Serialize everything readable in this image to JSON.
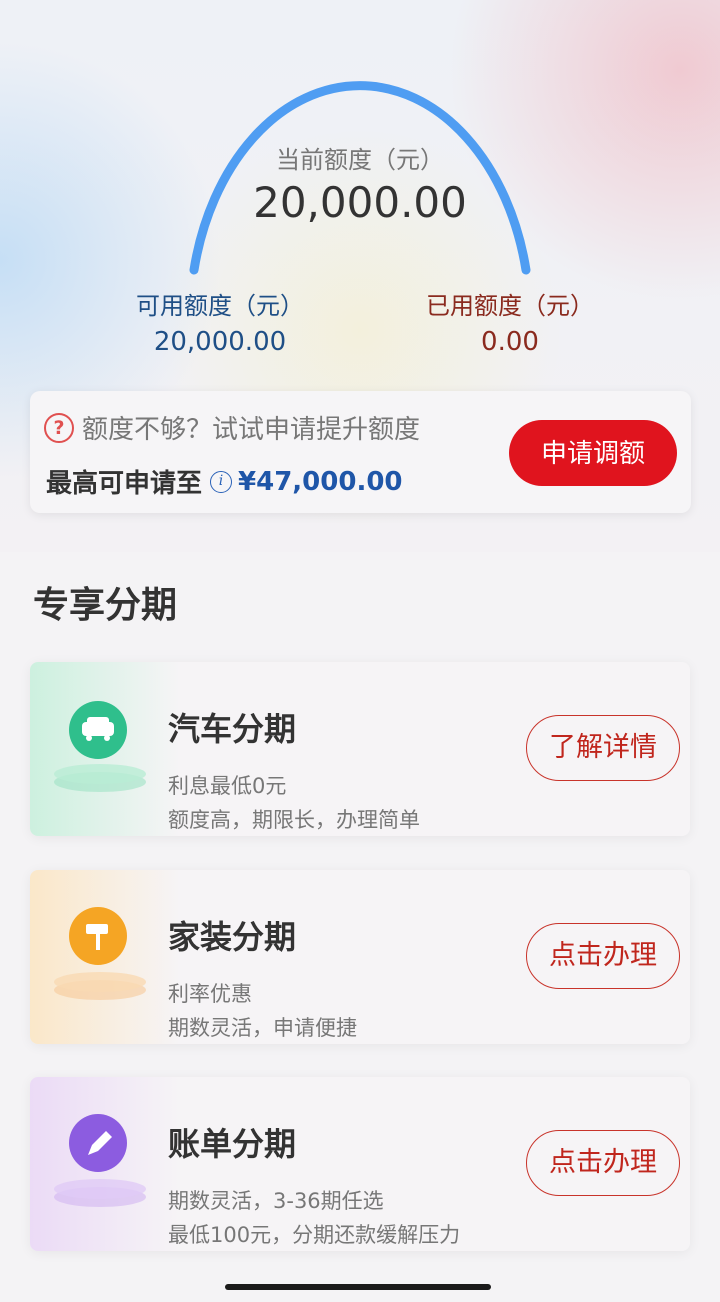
{
  "credit": {
    "current_label": "当前额度（元）",
    "current_value": "20,000.00",
    "available_label": "可用额度（元）",
    "available_value": "20,000.00",
    "used_label": "已用额度（元）",
    "used_value": "0.00"
  },
  "promo": {
    "question": "额度不够？试试申请提升额度",
    "max_label": "最高可申请至",
    "max_value": "¥47,000.00",
    "apply_button": "申请调额"
  },
  "section": {
    "title": "专享分期"
  },
  "cards": [
    {
      "title": "汽车分期",
      "sub1": "利息最低0元",
      "sub2": "额度高，期限长，办理简单",
      "button": "了解详情",
      "icon": "car-icon",
      "color": "#2fbf8c"
    },
    {
      "title": "家装分期",
      "sub1": "利率优惠",
      "sub2": "期数灵活，申请便捷",
      "button": "点击办理",
      "icon": "paint-roller-icon",
      "color": "#f5a524"
    },
    {
      "title": "账单分期",
      "sub1": "期数灵活，3-36期任选",
      "sub2": "最低100元，分期还款缓解压力",
      "button": "点击办理",
      "icon": "pen-icon",
      "color": "#8c5ce0"
    }
  ]
}
